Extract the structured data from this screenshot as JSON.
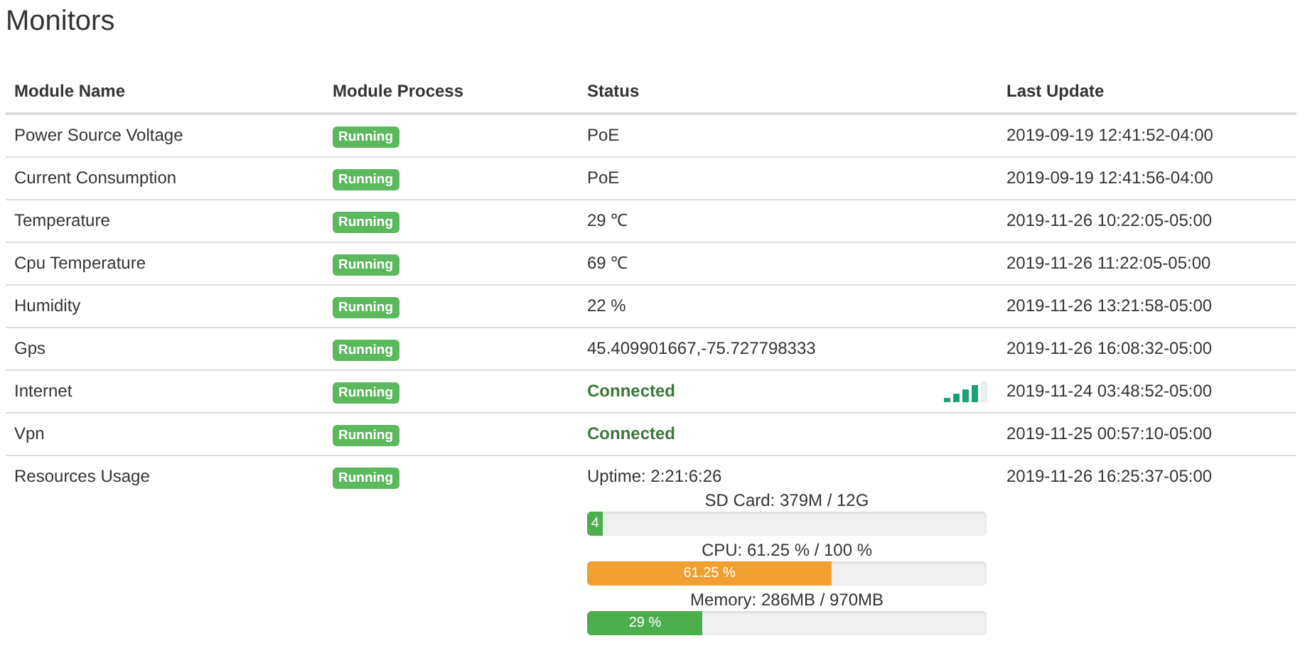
{
  "title": "Monitors",
  "columns": [
    "Module Name",
    "Module Process",
    "Status",
    "Last Update"
  ],
  "rows": [
    {
      "name": "Power Source Voltage",
      "process": "Running",
      "status": {
        "kind": "text",
        "text": "PoE"
      },
      "updated": "2019-09-19 12:41:52-04:00"
    },
    {
      "name": "Current Consumption",
      "process": "Running",
      "status": {
        "kind": "text",
        "text": "PoE"
      },
      "updated": "2019-09-19 12:41:56-04:00"
    },
    {
      "name": "Temperature",
      "process": "Running",
      "status": {
        "kind": "text",
        "text": "29 ℃"
      },
      "updated": "2019-11-26 10:22:05-05:00"
    },
    {
      "name": "Cpu Temperature",
      "process": "Running",
      "status": {
        "kind": "text",
        "text": "69 ℃"
      },
      "updated": "2019-11-26 11:22:05-05:00"
    },
    {
      "name": "Humidity",
      "process": "Running",
      "status": {
        "kind": "text",
        "text": "22 %"
      },
      "updated": "2019-11-26 13:21:58-05:00"
    },
    {
      "name": "Gps",
      "process": "Running",
      "status": {
        "kind": "text",
        "text": "45.409901667,-75.727798333"
      },
      "updated": "2019-11-26 16:08:32-05:00"
    },
    {
      "name": "Internet",
      "process": "Running",
      "status": {
        "kind": "connected",
        "text": "Connected",
        "signal": true
      },
      "updated": "2019-11-24 03:48:52-05:00"
    },
    {
      "name": "Vpn",
      "process": "Running",
      "status": {
        "kind": "connected",
        "text": "Connected",
        "signal": false
      },
      "updated": "2019-11-25 00:57:10-05:00"
    },
    {
      "name": "Resources Usage",
      "process": "Running",
      "status": {
        "kind": "resources",
        "uptime": "Uptime: 2:21:6:26",
        "meters": [
          {
            "caption": "SD Card: 379M / 12G",
            "label": "4",
            "level": 0.04,
            "color": "#4cae4c"
          },
          {
            "caption": "CPU: 61.25 % / 100 %",
            "label": "61.25 %",
            "level": 0.6125,
            "color": "#f0a030"
          },
          {
            "caption": "Memory: 286MB / 970MB",
            "label": "29 %",
            "level": 0.29,
            "color": "#4cae4c"
          }
        ]
      },
      "updated": "2019-11-26 16:25:37-05:00"
    }
  ]
}
